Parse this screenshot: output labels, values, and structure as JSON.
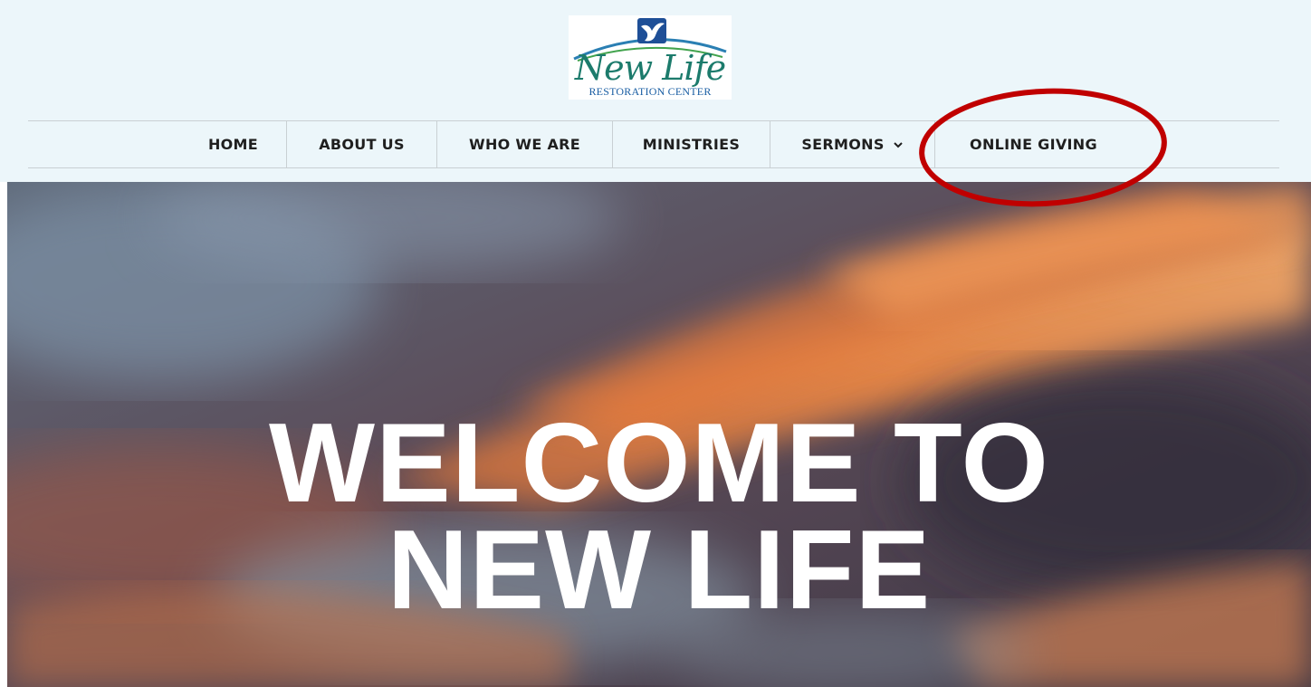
{
  "logo": {
    "wordmark": "New Life",
    "subtitle": "RESTORATION CENTER",
    "icon": "dove-icon"
  },
  "nav": {
    "items": [
      {
        "label": "HOME"
      },
      {
        "label": "ABOUT US"
      },
      {
        "label": "WHO WE ARE"
      },
      {
        "label": "MINISTRIES"
      },
      {
        "label": "SERMONS",
        "icon": "chevron-down-icon"
      },
      {
        "label": "ONLINE GIVING"
      }
    ]
  },
  "hero": {
    "title": "WELCOME TO\nNEW LIFE",
    "background": "sunset-sky-image"
  },
  "annotation": {
    "shape": "ellipse",
    "color": "#c00000",
    "target": "ONLINE GIVING"
  },
  "colors": {
    "header_bg": "#ecf6fa",
    "nav_text": "#1f1f1f",
    "logo_teal": "#1c7b6c",
    "logo_blue": "#1a5ea3"
  }
}
